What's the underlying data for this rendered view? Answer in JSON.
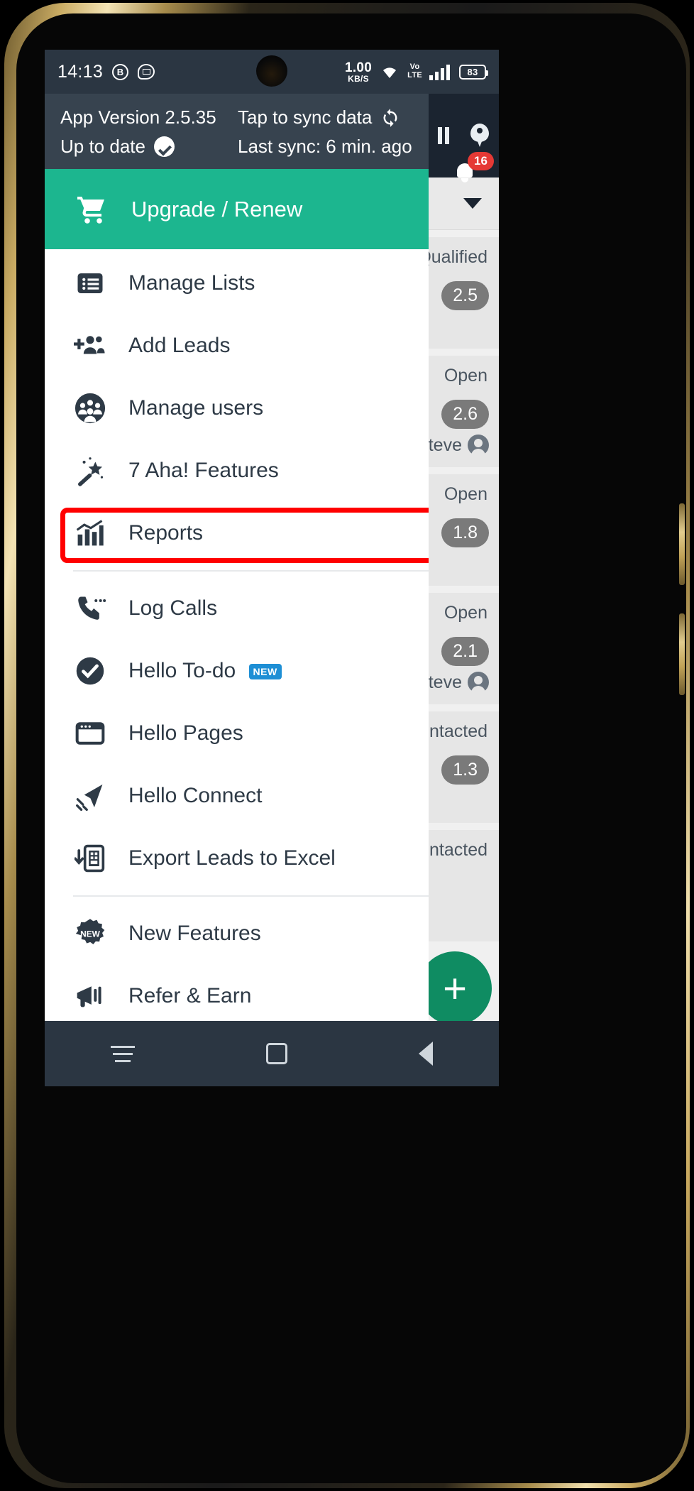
{
  "status_bar": {
    "time": "14:13",
    "icons": [
      "bitcoin-circle-icon",
      "chat-bubble-icon"
    ],
    "net_speed_value": "1.00",
    "net_speed_unit": "KB/S",
    "wifi": "wifi-icon",
    "volte_top": "Vo",
    "volte_bottom": "LTE",
    "signal": "signal-bars-icon",
    "battery_level": "83"
  },
  "drawer": {
    "app_version": "App Version 2.5.35",
    "up_to_date": "Up to date",
    "sync_prompt": "Tap to sync data",
    "last_sync": "Last sync: 6 min. ago",
    "upgrade": {
      "label": "Upgrade / Renew",
      "icon": "shopping-cart-icon",
      "bg_color": "#1cb68f"
    },
    "groups": [
      {
        "items": [
          {
            "label": "Manage Lists",
            "icon": "list-box-icon"
          },
          {
            "label": "Add Leads",
            "icon": "add-people-icon"
          },
          {
            "label": "Manage users",
            "icon": "manage-users-icon",
            "highlighted": true
          },
          {
            "label": "7 Aha! Features",
            "icon": "magic-wand-icon"
          },
          {
            "label": "Reports",
            "icon": "bar-chart-icon"
          }
        ]
      },
      {
        "items": [
          {
            "label": "Log Calls",
            "icon": "phone-call-icon"
          },
          {
            "label": "Hello To-do",
            "icon": "check-circle-icon",
            "badge": "NEW",
            "badge_color": "#1e8fd5"
          },
          {
            "label": "Hello Pages",
            "icon": "browser-window-icon"
          },
          {
            "label": "Hello Connect",
            "icon": "paper-plane-icon"
          },
          {
            "label": "Export Leads to Excel",
            "icon": "export-document-icon"
          }
        ]
      },
      {
        "items": [
          {
            "label": "New Features",
            "icon": "new-starburst-icon"
          },
          {
            "label": "Refer & Earn",
            "icon": "megaphone-icon"
          }
        ]
      }
    ]
  },
  "background_app": {
    "notification_count": "16",
    "location_icon": "map-pin-icon",
    "bell_icon": "bell-icon",
    "filter_caret": "chevron-down-icon",
    "fab_label": "+",
    "cards": [
      {
        "status": "Qualified",
        "score": "2.5",
        "owner": "",
        "tag_color": "#1b8f4f"
      },
      {
        "status": "Open",
        "score": "2.6",
        "owner": "Steve",
        "tag_color": "#c79a12"
      },
      {
        "status": "Open",
        "score": "1.8",
        "owner": "",
        "tag_color": "#1f5fa8"
      },
      {
        "status": "Open",
        "score": "2.1",
        "owner": "Steve",
        "tag_color": "#c79a12"
      },
      {
        "status": "Contacted",
        "score": "1.3",
        "owner": "",
        "tag_color": "#1f5fa8"
      },
      {
        "status": "Contacted",
        "score": "",
        "owner": "",
        "tag_color": "#1f5fa8"
      }
    ]
  },
  "nav_bar": {
    "recents": "recents-icon",
    "home": "home-icon",
    "back": "back-icon"
  },
  "colors": {
    "accent_green": "#1cb68f",
    "header_dark": "#37434f",
    "status_dark": "#2b3642",
    "highlight_red": "#ff0000"
  }
}
